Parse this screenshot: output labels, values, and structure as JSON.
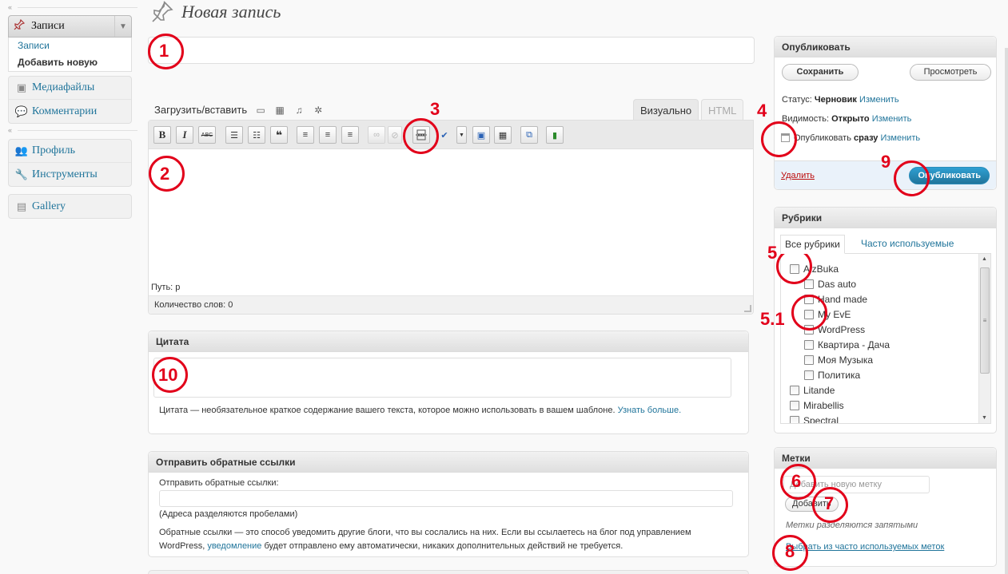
{
  "sidebar": {
    "posts_menu": {
      "label": "Записи",
      "items": [
        "Записи",
        "Добавить новую"
      ]
    },
    "group2": [
      "Медиафайлы",
      "Комментарии"
    ],
    "group3": [
      "Профиль",
      "Инструменты"
    ],
    "group4": [
      "Gallery"
    ]
  },
  "page": {
    "title": "Новая запись"
  },
  "editor": {
    "upload_label": "Загрузить/вставить",
    "tabs": [
      "Визуально",
      "HTML"
    ],
    "toolbar": {
      "bold": "B",
      "italic": "I",
      "strike": "ABC",
      "quote": "❝"
    },
    "path": "Путь: p",
    "word_count": "Количество слов: 0"
  },
  "excerpt": {
    "title": "Цитата",
    "help_text": "Цитата — необязательное краткое содержание вашего текста, которое можно использовать в вашем шаблоне.",
    "learn_more": "Узнать больше."
  },
  "trackbacks": {
    "title": "Отправить обратные ссылки",
    "field_label": "Отправить обратные ссылки:",
    "note": "(Адреса разделяются пробелами)",
    "help_part1": "Обратные ссылки — это способ уведомить другие блоги, что вы сослались на них. Если вы ссылаетесь на блог под управлением WordPress,",
    "help_link": "уведомление",
    "help_part2": "будет отправлено ему автоматически, никаких дополнительных действий не требуется."
  },
  "publish": {
    "title": "Опубликовать",
    "save": "Сохранить",
    "preview": "Просмотреть",
    "status_label": "Статус:",
    "status_value": "Черновик",
    "visibility_label": "Видимость:",
    "visibility_value": "Открыто",
    "schedule_label": "Опубликовать",
    "schedule_value": "сразу",
    "edit": "Изменить",
    "delete": "Удалить",
    "publish_button": "Опубликовать"
  },
  "categories": {
    "title": "Рубрики",
    "tab_all": "Все рубрики",
    "tab_popular": "Часто используемые",
    "items": [
      {
        "name": "AlzBuka",
        "level": 0
      },
      {
        "name": "Das auto",
        "level": 1
      },
      {
        "name": "Hand made",
        "level": 1
      },
      {
        "name": "My EvE",
        "level": 1
      },
      {
        "name": "WordPress",
        "level": 1
      },
      {
        "name": "Квартира - Дача",
        "level": 1
      },
      {
        "name": "Моя Музыка",
        "level": 1
      },
      {
        "name": "Политика",
        "level": 1
      },
      {
        "name": "Litande",
        "level": 0
      },
      {
        "name": "Mirabellis",
        "level": 0
      },
      {
        "name": "Spectral",
        "level": 0
      }
    ]
  },
  "tags": {
    "title": "Метки",
    "placeholder": "Добавить новую метку",
    "add_button": "Добавить",
    "hint": "Метки разделяются запятыми",
    "choose_link": "Выбрать из часто используемых меток"
  },
  "annotations": [
    "1",
    "2",
    "3",
    "4",
    "5",
    "5.1",
    "6",
    "7",
    "8",
    "9",
    "10"
  ],
  "colors": {
    "annotation": "#e2001a",
    "link": "#21759b",
    "publish_button": "#21759b",
    "delete_link": "#bc0b0b"
  }
}
